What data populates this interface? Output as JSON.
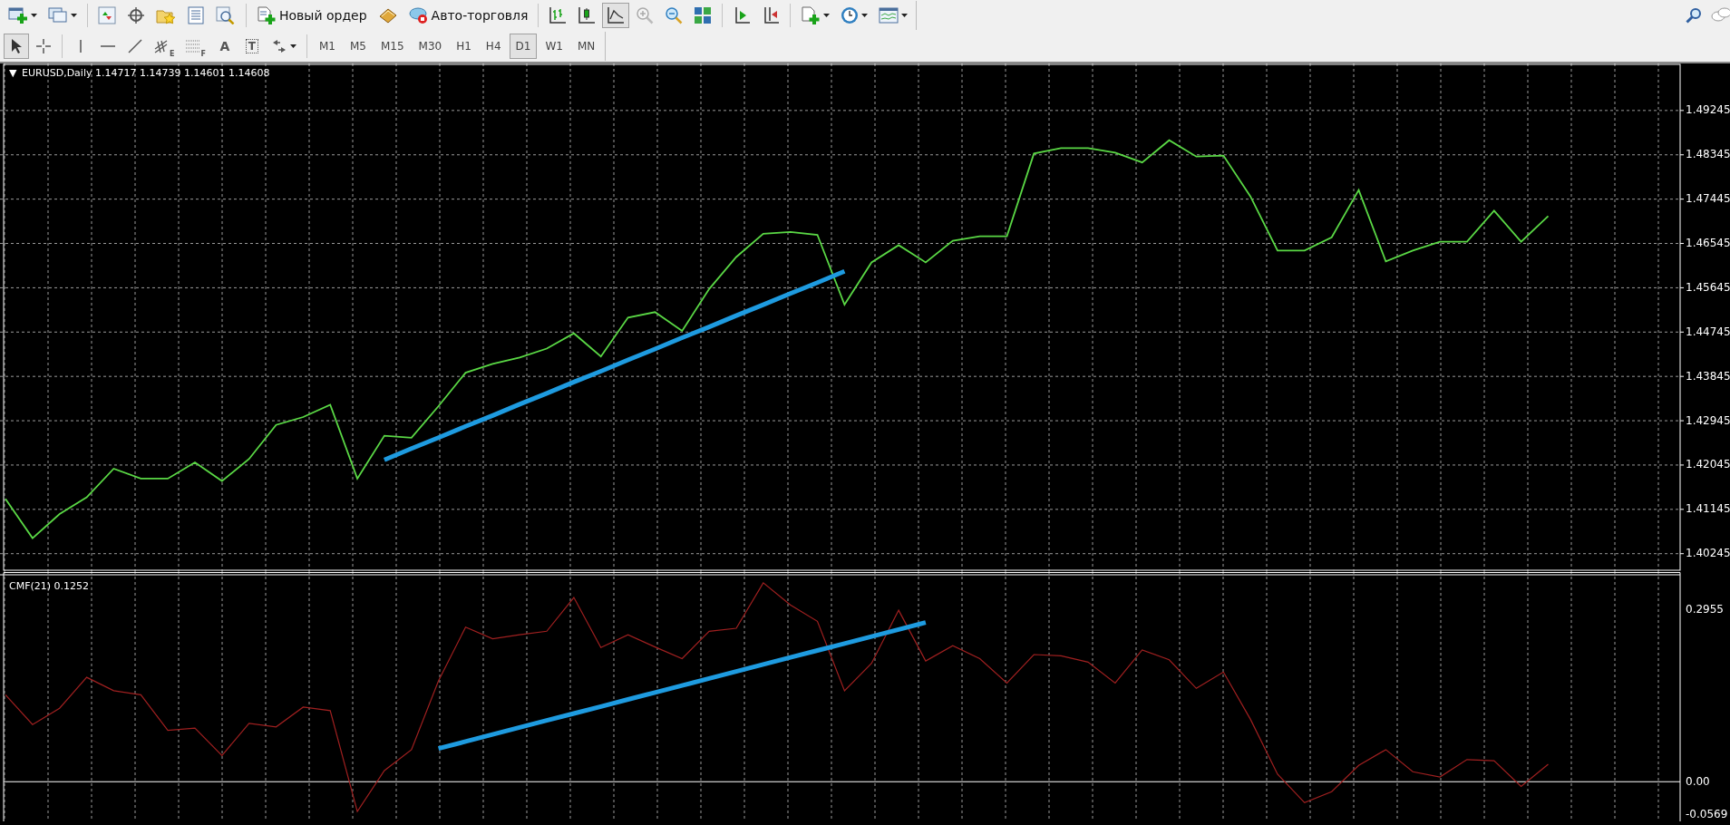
{
  "toolbar": {
    "new_order_button": {
      "label": "Новый ордер"
    },
    "auto_trading_button": {
      "label": "Авто-торговля"
    },
    "chart_types": [
      {
        "selected": false
      },
      {
        "selected": false
      },
      {
        "selected": true
      }
    ]
  },
  "drawing_toolbar": {
    "pointer_tools": [
      {
        "selected": true
      },
      {
        "selected": false
      }
    ],
    "channel_tool": {
      "sub": "E"
    },
    "fibonacci_tool": {
      "sub": "F"
    },
    "text_tool": {
      "glyph": "A"
    },
    "text_label_tool": {
      "glyph": "T"
    },
    "periods": [
      {
        "label": "M1",
        "selected": false
      },
      {
        "label": "M5",
        "selected": false
      },
      {
        "label": "M15",
        "selected": false
      },
      {
        "label": "M30",
        "selected": false
      },
      {
        "label": "H1",
        "selected": false
      },
      {
        "label": "H4",
        "selected": false
      },
      {
        "label": "D1",
        "selected": true
      },
      {
        "label": "W1",
        "selected": false
      },
      {
        "label": "MN",
        "selected": false
      }
    ]
  },
  "price_chart": {
    "toggle": "▼",
    "prices": "1.14717 1.14739 1.14601 1.14608",
    "chart_data": {
      "type": "line",
      "grid": true,
      "ylim": [
        1.3989,
        1.502
      ],
      "yticks": [
        1.40245,
        1.41145,
        1.42045,
        1.42945,
        1.43845,
        1.44745,
        1.45645,
        1.46545,
        1.47445,
        1.48345,
        1.49245
      ],
      "series": [
        {
          "name": "EURUSD,Daily",
          "color": "#5ad845",
          "values": [
            1.4136,
            1.4056,
            1.4105,
            1.4139,
            1.4197,
            1.4177,
            1.4177,
            1.421,
            1.4172,
            1.4217,
            1.4286,
            1.4302,
            1.4327,
            1.4177,
            1.4264,
            1.426,
            1.4324,
            1.4392,
            1.441,
            1.4423,
            1.4441,
            1.4472,
            1.4425,
            1.4504,
            1.4515,
            1.4477,
            1.4562,
            1.4627,
            1.4674,
            1.4678,
            1.4672,
            1.453,
            1.4616,
            1.4651,
            1.4616,
            1.466,
            1.4669,
            1.4669,
            1.4837,
            1.4848,
            1.4848,
            1.4839,
            1.4819,
            1.4864,
            1.4831,
            1.4833,
            1.475,
            1.464,
            1.464,
            1.4667,
            1.4763,
            1.4618,
            1.464,
            1.4658,
            1.4658,
            1.4721,
            1.4658,
            1.471
          ]
        },
        {
          "color": "#1e9be0",
          "values": [
            null,
            null,
            null,
            null,
            null,
            null,
            null,
            null,
            null,
            null,
            null,
            null,
            null,
            null,
            1.4215,
            1.4238,
            1.426,
            1.4283,
            1.4305,
            1.4328,
            1.435,
            1.4373,
            1.4395,
            1.4418,
            1.444,
            1.4463,
            1.4485,
            1.4508,
            1.453,
            1.4553,
            1.4575,
            1.4598,
            null,
            null,
            null,
            null,
            null,
            null,
            null,
            null,
            null,
            null,
            null,
            null,
            null,
            null,
            null,
            null,
            null,
            null,
            null,
            null,
            null,
            null,
            null,
            null,
            null,
            null
          ]
        }
      ]
    }
  },
  "indicator_chart": {
    "value": "0.1252",
    "chart_data": {
      "type": "line",
      "grid": true,
      "ylim": [
        -0.068,
        0.361
      ],
      "yticks": [
        0.2955,
        {
          "value": 0,
          "label": "0.00"
        },
        -0.0569
      ],
      "series": [
        {
          "name": "CMF(21)",
          "color": "#a02020",
          "values": [
            0.149,
            0.098,
            0.126,
            0.179,
            0.156,
            0.149,
            0.088,
            0.092,
            0.045,
            0.1,
            0.094,
            0.128,
            0.122,
            -0.051,
            0.019,
            0.055,
            0.173,
            0.265,
            0.245,
            0.252,
            0.258,
            0.316,
            0.23,
            0.252,
            0.231,
            0.211,
            0.258,
            0.263,
            0.341,
            0.303,
            0.275,
            0.156,
            0.203,
            0.294,
            0.207,
            0.233,
            0.211,
            0.169,
            0.218,
            0.216,
            0.205,
            0.169,
            0.226,
            0.209,
            0.16,
            0.188,
            0.107,
            0.013,
            -0.036,
            -0.017,
            0.028,
            0.055,
            0.017,
            0.008,
            0.038,
            0.036,
            -0.008,
            0.03
          ]
        },
        {
          "color": "#1e9be0",
          "values": [
            null,
            null,
            null,
            null,
            null,
            null,
            null,
            null,
            null,
            null,
            null,
            null,
            null,
            null,
            null,
            null,
            0.057,
            0.069,
            0.081,
            0.093,
            0.105,
            0.117,
            0.129,
            0.141,
            0.153,
            0.165,
            0.177,
            0.189,
            0.201,
            0.213,
            0.225,
            0.237,
            0.249,
            0.261,
            0.273,
            null,
            null,
            null,
            null,
            null,
            null,
            null,
            null,
            null,
            null,
            null,
            null,
            null,
            null,
            null,
            null,
            null,
            null,
            null,
            null,
            null,
            null,
            null
          ]
        }
      ]
    }
  }
}
